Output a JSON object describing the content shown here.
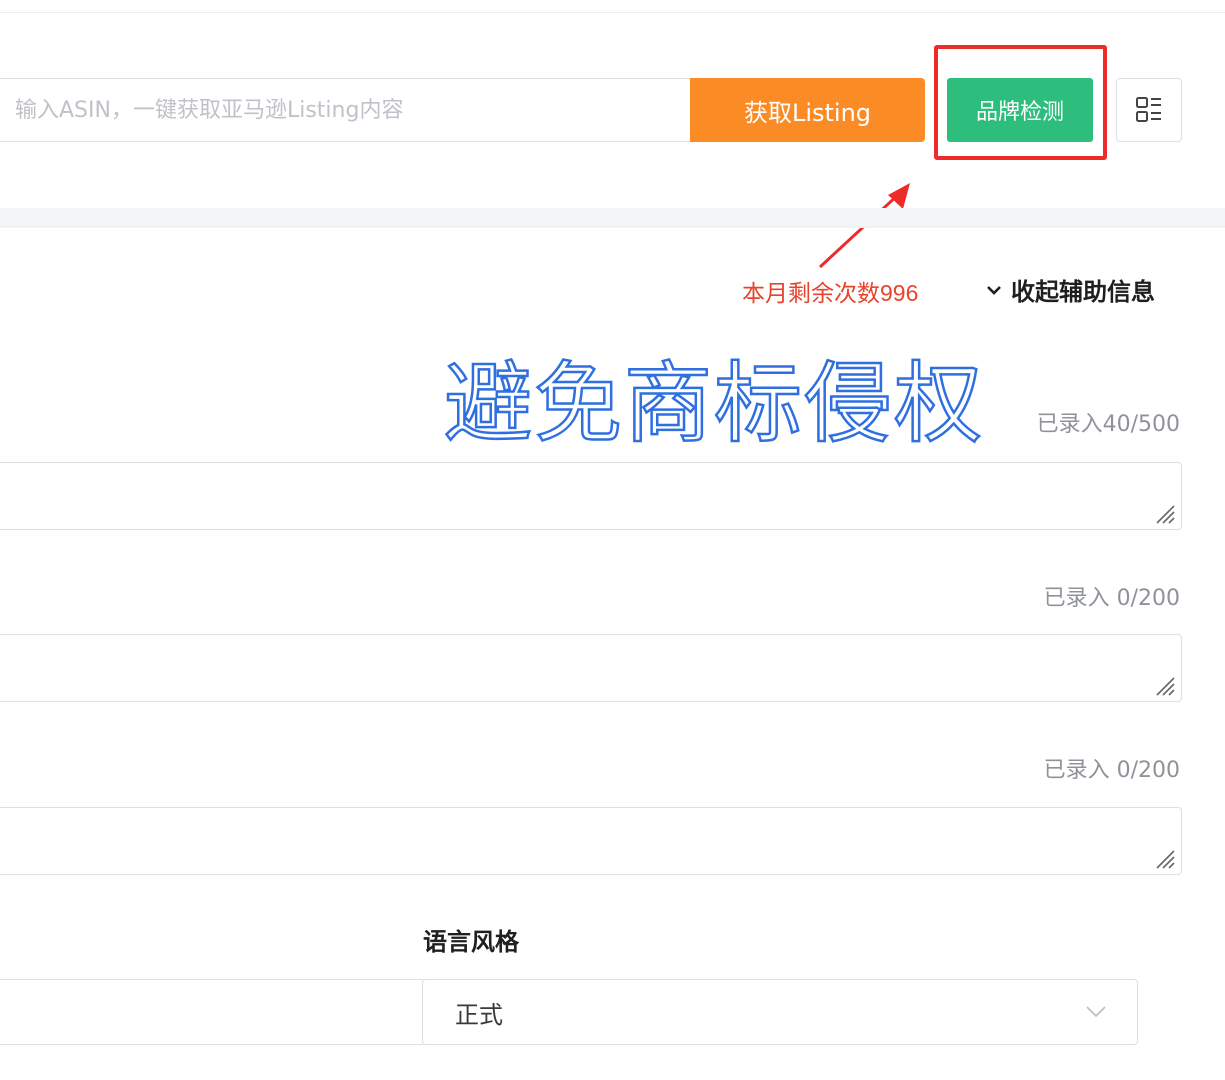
{
  "toolbar": {
    "asin_placeholder": "输入ASIN，一键获取亚马逊Listing内容",
    "fetch_label": "获取Listing",
    "brand_check_label": "品牌检测"
  },
  "header": {
    "remaining_prefix": "本月剩余次数",
    "remaining_count": "996",
    "collapse_label": "收起辅助信息"
  },
  "watermark": "避免商标侵权",
  "fields": [
    {
      "counter": "已录入40/500",
      "value": ""
    },
    {
      "counter": "已录入 0/200",
      "value": ""
    },
    {
      "counter": "已录入 0/200",
      "value": ""
    }
  ],
  "language_style": {
    "label": "语言风格",
    "selected": "正式"
  },
  "colors": {
    "fetch_orange": "#fb8c25",
    "brand_green": "#2dbe7e",
    "highlight_red": "#ee2b2b",
    "remaining_red": "#e8432c",
    "watermark_blue": "#2f6fe0"
  },
  "icons": [
    "layout-toggle-icon",
    "chevron-down-icon",
    "resize-grip-icon",
    "annotation-arrow"
  ]
}
